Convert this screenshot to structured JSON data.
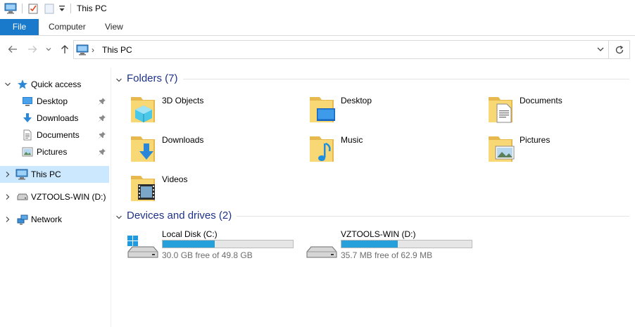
{
  "window": {
    "title": "This PC"
  },
  "ribbon": {
    "tabs": [
      {
        "label": "File"
      },
      {
        "label": "Computer"
      },
      {
        "label": "View"
      }
    ]
  },
  "address": {
    "crumb": "This PC"
  },
  "nav": {
    "quick_access": "Quick access",
    "quick_items": [
      {
        "label": "Desktop"
      },
      {
        "label": "Downloads"
      },
      {
        "label": "Documents"
      },
      {
        "label": "Pictures"
      }
    ],
    "this_pc": "This PC",
    "drive": "VZTOOLS-WIN (D:)",
    "network": "Network"
  },
  "content": {
    "folders_header": "Folders (7)",
    "folders": [
      {
        "name": "3D Objects",
        "icon": "3d-objects-icon"
      },
      {
        "name": "Desktop",
        "icon": "desktop-icon"
      },
      {
        "name": "Documents",
        "icon": "documents-icon"
      },
      {
        "name": "Downloads",
        "icon": "downloads-icon"
      },
      {
        "name": "Music",
        "icon": "music-icon"
      },
      {
        "name": "Pictures",
        "icon": "pictures-icon"
      },
      {
        "name": "Videos",
        "icon": "videos-icon"
      }
    ],
    "drives_header": "Devices and drives (2)",
    "drives": [
      {
        "name": "Local Disk (C:)",
        "free_text": "30.0 GB free of 49.8 GB",
        "used_fraction": 0.398
      },
      {
        "name": "VZTOOLS-WIN (D:)",
        "free_text": "35.7 MB free of 62.9 MB",
        "used_fraction": 0.432
      }
    ]
  },
  "colors": {
    "accent": "#1979ca",
    "selection": "#cce8ff",
    "group_header": "#1e3287",
    "drive_bar": "#26a0da",
    "folder": "#f8d775"
  }
}
